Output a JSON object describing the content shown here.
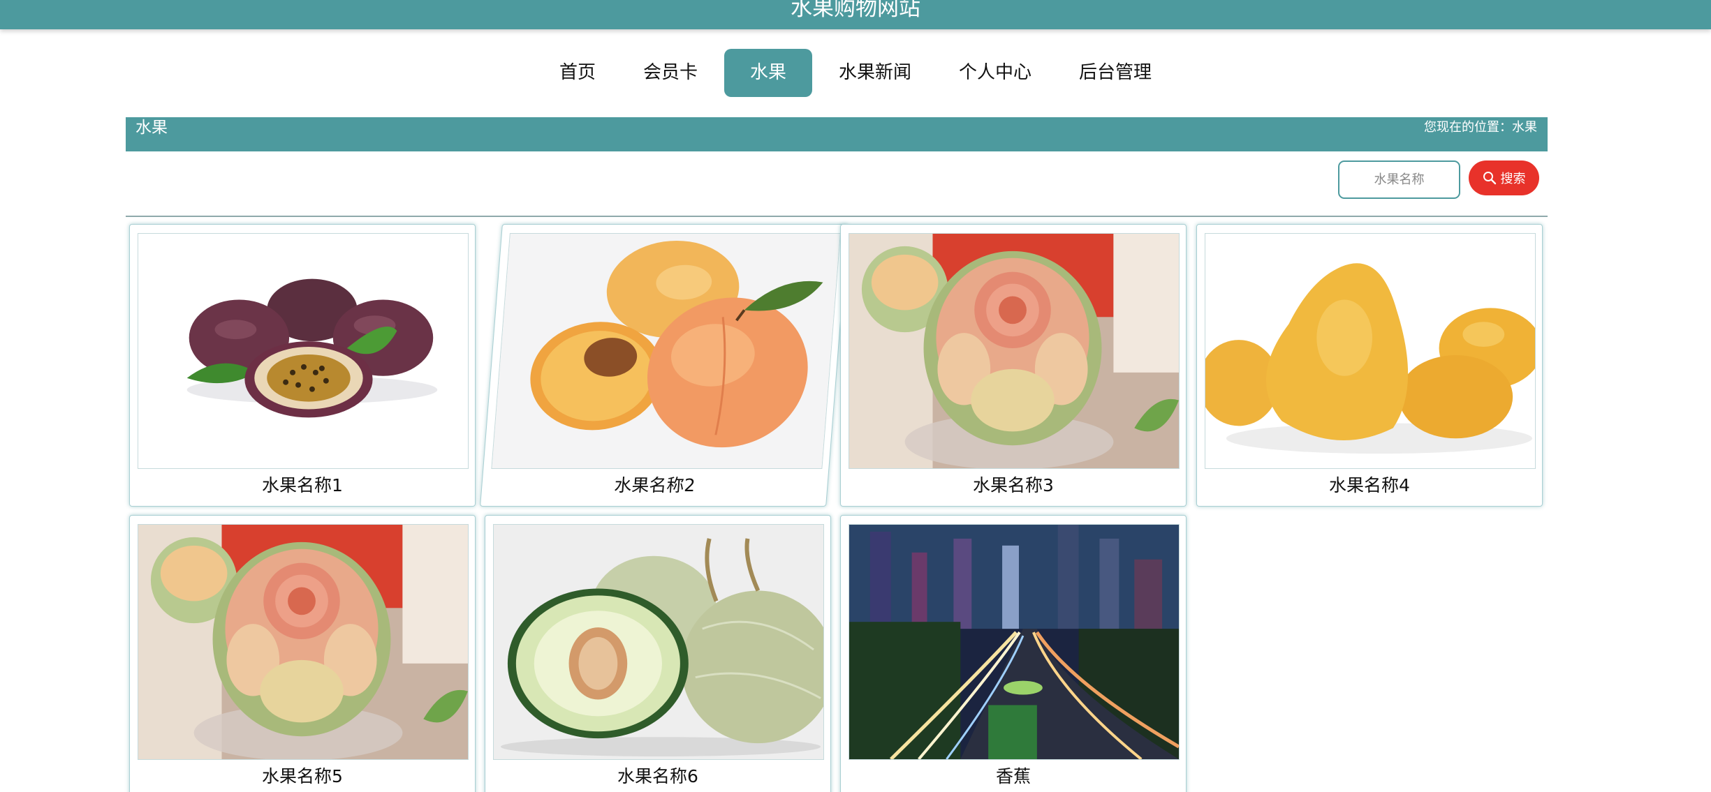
{
  "header": {
    "title": "水果购物网站"
  },
  "nav": {
    "items": [
      {
        "label": "首页",
        "active": false
      },
      {
        "label": "会员卡",
        "active": false
      },
      {
        "label": "水果",
        "active": true
      },
      {
        "label": "水果新闻",
        "active": false
      },
      {
        "label": "个人中心",
        "active": false
      },
      {
        "label": "后台管理",
        "active": false
      }
    ]
  },
  "section": {
    "title": "水果",
    "location": "您现在的位置：水果"
  },
  "search": {
    "placeholder": "水果名称",
    "button_label": "搜索",
    "icon": "search-icon"
  },
  "products": [
    {
      "name": "水果名称1",
      "image": "passion-fruit"
    },
    {
      "name": "水果名称2",
      "image": "apricots"
    },
    {
      "name": "水果名称3",
      "image": "carved-melon"
    },
    {
      "name": "水果名称4",
      "image": "mangoes"
    },
    {
      "name": "水果名称5",
      "image": "carved-melon"
    },
    {
      "name": "水果名称6",
      "image": "cantaloupe"
    },
    {
      "name": "香蕉",
      "image": "city-night-road"
    }
  ],
  "colors": {
    "primary": "#4d9a9e",
    "search_button": "#e8322a",
    "background": "#ffffff"
  }
}
